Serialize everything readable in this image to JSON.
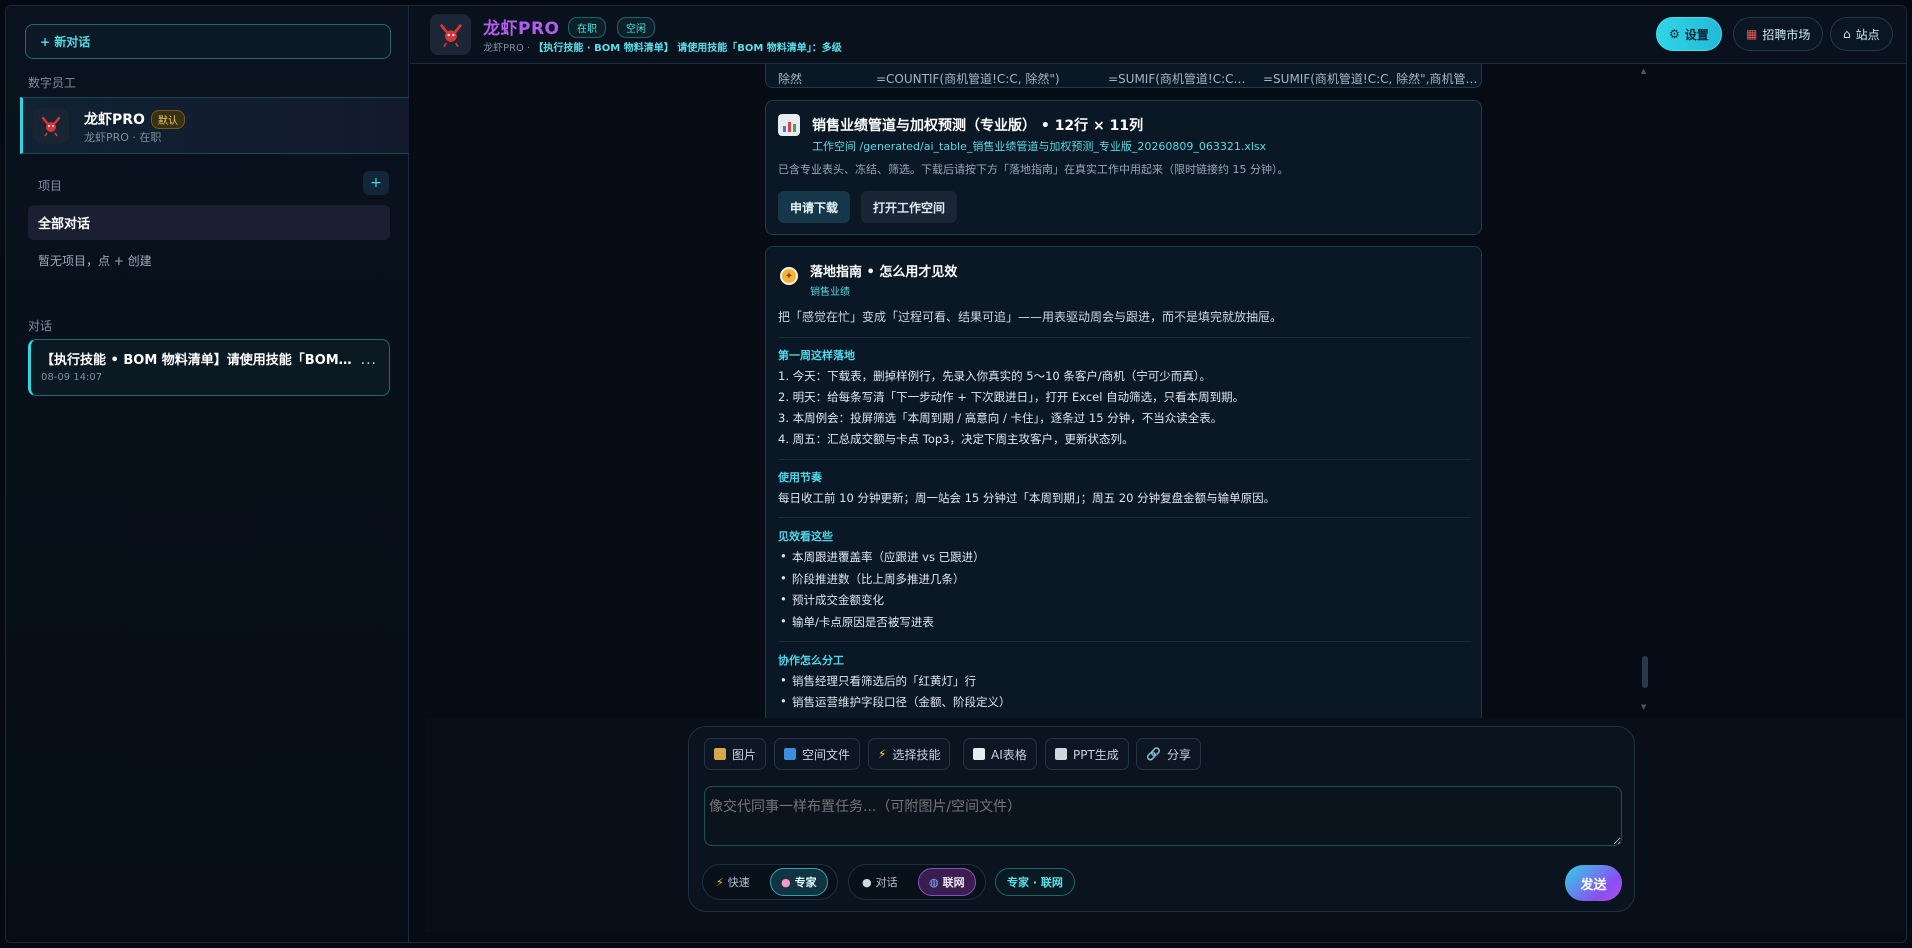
{
  "sidebar": {
    "new_chat": "+ 新对话",
    "employees_label": "数字员工",
    "employee": {
      "name": "龙虾PRO",
      "badge": "默认",
      "sub": "龙虾PRO · 在职"
    },
    "projects_label": "项目",
    "add_project": "+",
    "all_chats": "全部对话",
    "empty_projects": "暂无项目，点 + 创建",
    "chats_label": "对话",
    "chat": {
      "title": "【执行技能 • BOM 物料清单】请使用技能「BOM…",
      "time": "08-09 14:07",
      "more": "···"
    }
  },
  "header": {
    "title": "龙虾PRO",
    "tags": [
      "在职",
      "空闲"
    ],
    "sub_prefix": "龙虾PRO ·",
    "sub_task": "【执行技能 · BOM 物料清单】 请使用技能「BOM 物料清单」：多级",
    "buttons": {
      "settings": "设置",
      "market": "招聘市场",
      "site": "站点"
    }
  },
  "messages": {
    "snippet": [
      "除然",
      "=COUNTIF(商机管道!C:C, 除然\")",
      "=SUMIF(商机管道!C:C…",
      "=SUMIF(商机管道!C:C, 除然\",商机管…"
    ],
    "file_card": {
      "title": "销售业绩管道与加权预测（专业版） • 12行 × 11列",
      "path": "工作空间 /generated/ai_table_销售业绩管道与加权预测_专业版_20260809_063321.xlsx",
      "desc": "已含专业表头、冻结、筛选。下载后请按下方「落地指南」在真实工作中用起来（限时链接约 15 分钟）。",
      "download": "申请下载",
      "open_workspace": "打开工作空间"
    },
    "guide": {
      "title": "落地指南 • 怎么用才见效",
      "tag": "销售业绩",
      "intro": "把「感觉在忙」变成「过程可看、结果可追」——用表驱动周会与跟进，而不是填完就放抽屉。",
      "week_title": "第一周这样落地",
      "week_items": [
        "1. 今天：下载表，删掉样例行，先录入你真实的 5～10 条客户/商机（宁可少而真）。",
        "2. 明天：给每条写清「下一步动作 + 下次跟进日」，打开 Excel 自动筛选，只看本周到期。",
        "3. 本周例会：投屏筛选「本周到期 / 高意向 / 卡住」，逐条过 15 分钟，不当众读全表。",
        "4. 周五：汇总成交额与卡点 Top3，决定下周主攻客户，更新状态列。"
      ],
      "rhythm_title": "使用节奏",
      "rhythm_text": "每日收工前 10 分钟更新；周一站会 15 分钟过「本周到期」；周五 20 分钟复盘金额与输单原因。",
      "effect_title": "见效看这些",
      "effect_items": [
        "本周跟进覆盖率（应跟进 vs 已跟进）",
        "阶段推进数（比上周多推进几条）",
        "预计成交金额变化",
        "输单/卡点原因是否被写进表"
      ],
      "team_title": "协作怎么分工",
      "team_items": [
        "销售经理只看筛选后的「红黄灯」行",
        "销售运营维护字段口径（金额、阶段定义）"
      ]
    }
  },
  "composer": {
    "tools": [
      "图片",
      "空间文件",
      "选择技能",
      "AI表格",
      "PPT生成",
      "分享"
    ],
    "placeholder": "像交代同事一样布置任务...（可附图片/空间文件）",
    "speed": {
      "fast": "快速",
      "expert": "专家"
    },
    "mode": {
      "chat": "对话",
      "web": "联网"
    },
    "mode_chip": "专家 · 联网",
    "send": "发送"
  },
  "colors": {
    "accent": "#2fd5df",
    "purple": "#b25cf0",
    "bg": "#060c15"
  },
  "icons": [
    "lobster-avatar-icon",
    "gear-icon",
    "shop-icon",
    "home-icon",
    "chart-file-icon",
    "compass-icon",
    "image-icon",
    "folder-icon",
    "bolt-icon",
    "table-icon",
    "doc-icon",
    "link-icon",
    "chat-icon",
    "globe-icon",
    "brain-icon"
  ]
}
